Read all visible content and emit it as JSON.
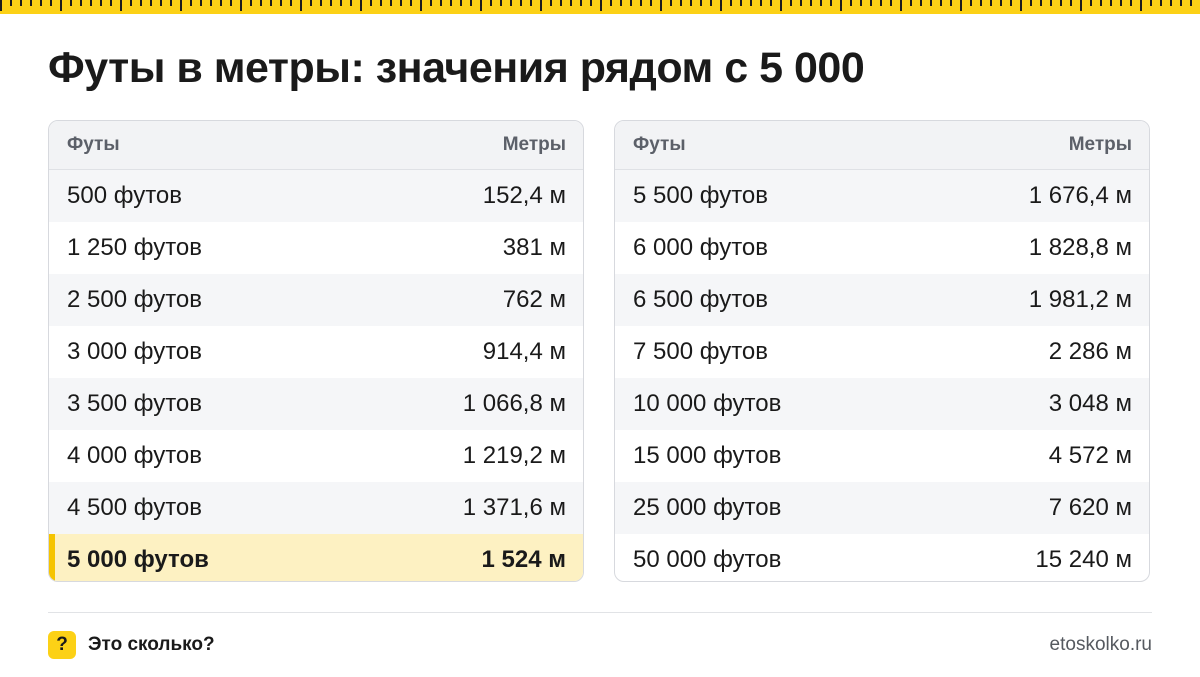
{
  "title": "Футы в метры: значения рядом с 5 000",
  "colors": {
    "accent": "#fcd116",
    "highlight_row": "#fdf1c2",
    "highlight_bar": "#f5c400",
    "header_bg": "#f2f3f5",
    "stripe": "#f5f6f8"
  },
  "tables": [
    {
      "header": {
        "feet": "Футы",
        "meters": "Метры"
      },
      "rows": [
        {
          "feet": "500 футов",
          "meters": "152,4 м"
        },
        {
          "feet": "1 250 футов",
          "meters": "381 м"
        },
        {
          "feet": "2 500 футов",
          "meters": "762 м"
        },
        {
          "feet": "3 000 футов",
          "meters": "914,4 м"
        },
        {
          "feet": "3 500 футов",
          "meters": "1 066,8 м"
        },
        {
          "feet": "4 000 футов",
          "meters": "1 219,2 м"
        },
        {
          "feet": "4 500 футов",
          "meters": "1 371,6 м"
        },
        {
          "feet": "5 000 футов",
          "meters": "1 524 м",
          "highlighted": true
        }
      ]
    },
    {
      "header": {
        "feet": "Футы",
        "meters": "Метры"
      },
      "rows": [
        {
          "feet": "5 500 футов",
          "meters": "1 676,4 м"
        },
        {
          "feet": "6 000 футов",
          "meters": "1 828,8 м"
        },
        {
          "feet": "6 500 футов",
          "meters": "1 981,2 м"
        },
        {
          "feet": "7 500 футов",
          "meters": "2 286 м"
        },
        {
          "feet": "10 000 футов",
          "meters": "3 048 м"
        },
        {
          "feet": "15 000 футов",
          "meters": "4 572 м"
        },
        {
          "feet": "25 000 футов",
          "meters": "7 620 м"
        },
        {
          "feet": "50 000 футов",
          "meters": "15 240 м"
        }
      ]
    }
  ],
  "footer": {
    "badge_symbol": "?",
    "brand": "Это сколько?",
    "site": "etoskolko.ru"
  }
}
